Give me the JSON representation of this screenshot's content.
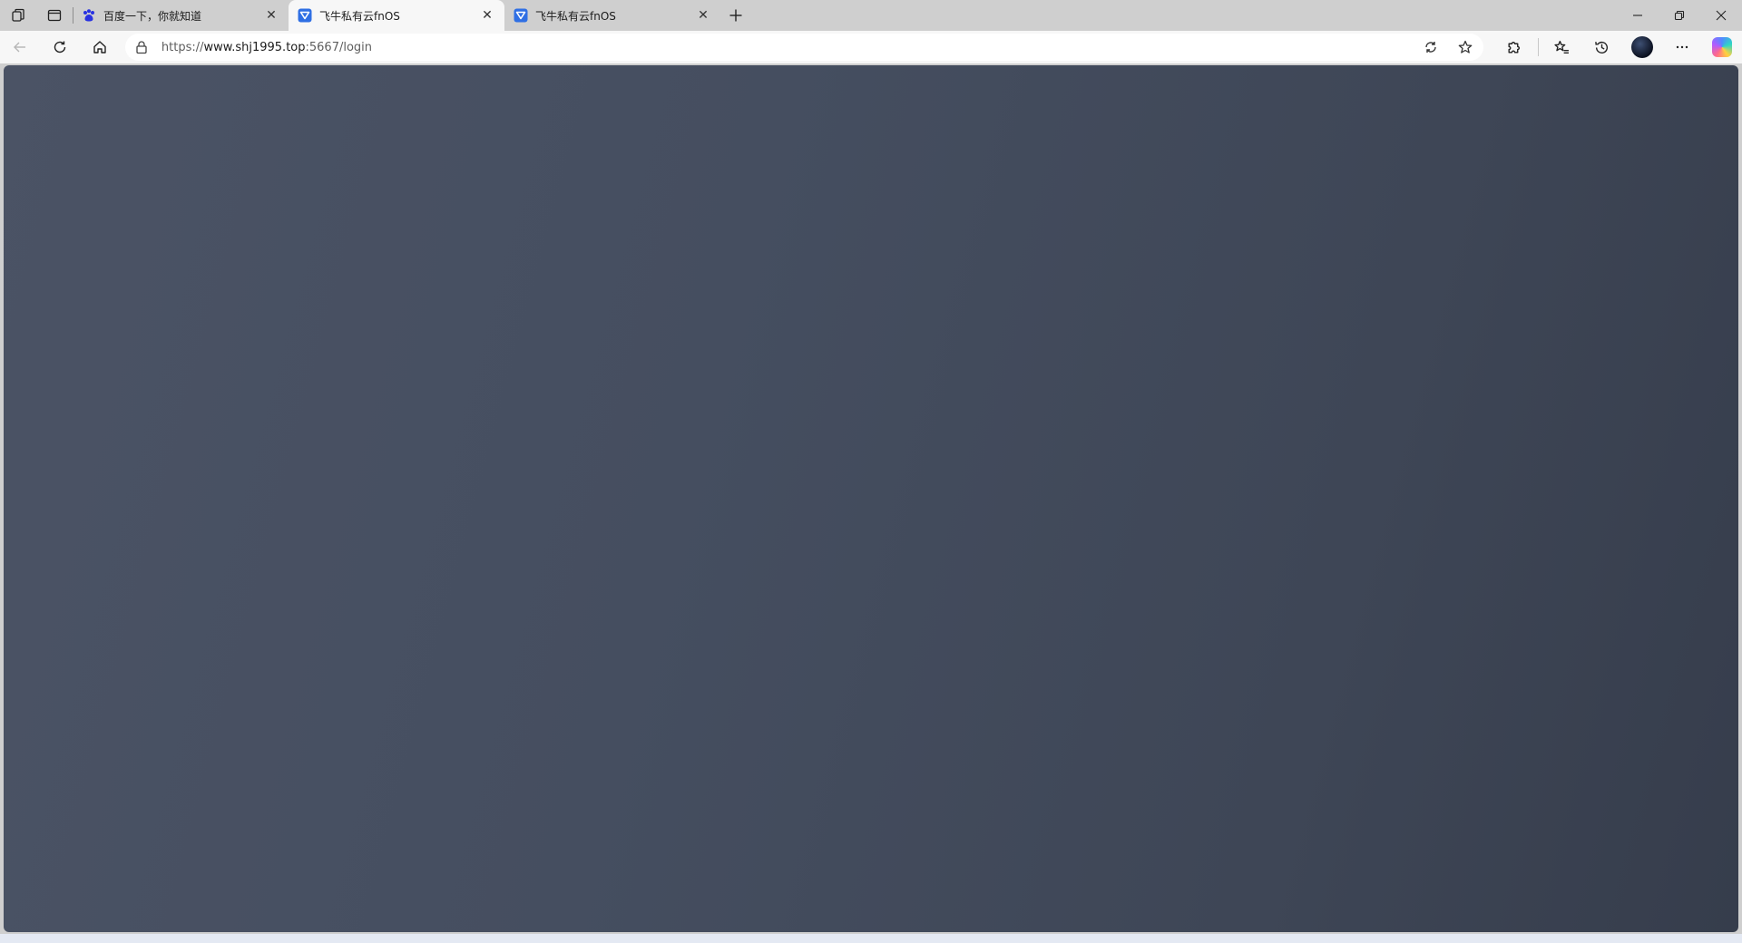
{
  "tabs": [
    {
      "title": "百度一下，你就知道",
      "active": false,
      "favicon": "baidu-paw-icon"
    },
    {
      "title": "飞牛私有云fnOS",
      "active": true,
      "favicon": "fnos-icon"
    },
    {
      "title": "飞牛私有云fnOS",
      "active": false,
      "favicon": "fnos-icon"
    }
  ],
  "address_bar": {
    "scheme": "https://",
    "host": "www.shj1995.top",
    "rest": ":5667/login"
  },
  "colors": {
    "page_background_start": "#4b5365",
    "page_background_end": "#363d4c",
    "chrome_background": "#cfcfcf",
    "active_tab": "#f7f7f7"
  }
}
